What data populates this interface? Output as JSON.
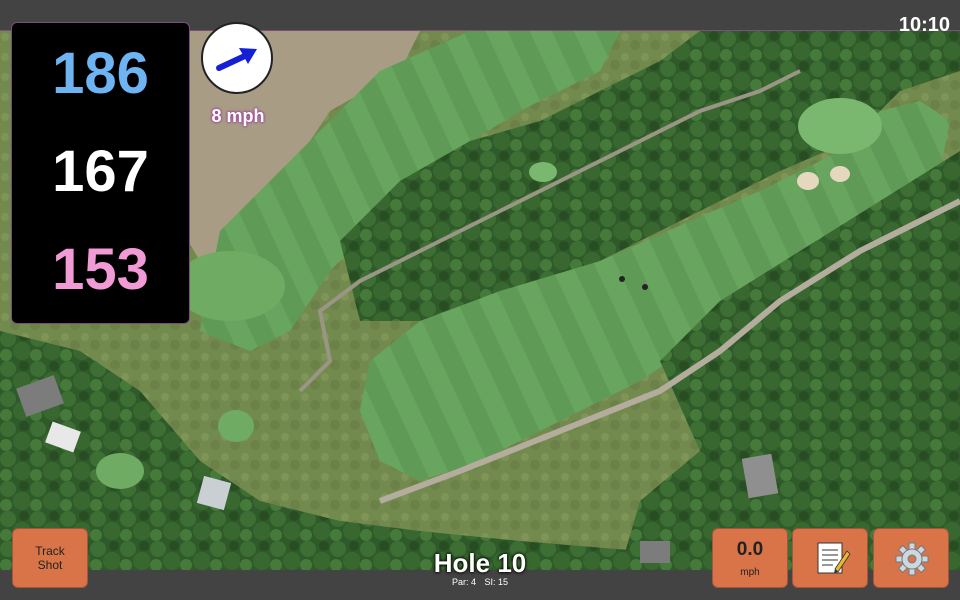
{
  "status": {
    "clock": "10:10"
  },
  "distances": {
    "back": "186",
    "middle": "167",
    "front": "153"
  },
  "wind": {
    "speed_label": "8 mph",
    "icon": "arrow-right-icon",
    "arrow_color": "#1520d6"
  },
  "hole": {
    "title": "Hole 10",
    "par": "Par: 4",
    "si": "SI: 15"
  },
  "buttons": {
    "track_line1": "Track",
    "track_line2": "Shot",
    "speed_value": "0.0",
    "speed_unit": "mph",
    "notes_icon": "scorecard-notepad-icon",
    "settings_icon": "gear-icon"
  },
  "colors": {
    "back": "#6eb4f3",
    "middle": "#ffffff",
    "front": "#f09ad6",
    "button": "#d87447",
    "accent_border": "#7a4f7c"
  },
  "map": {
    "type": "satellite-aerial-golf-hole"
  }
}
